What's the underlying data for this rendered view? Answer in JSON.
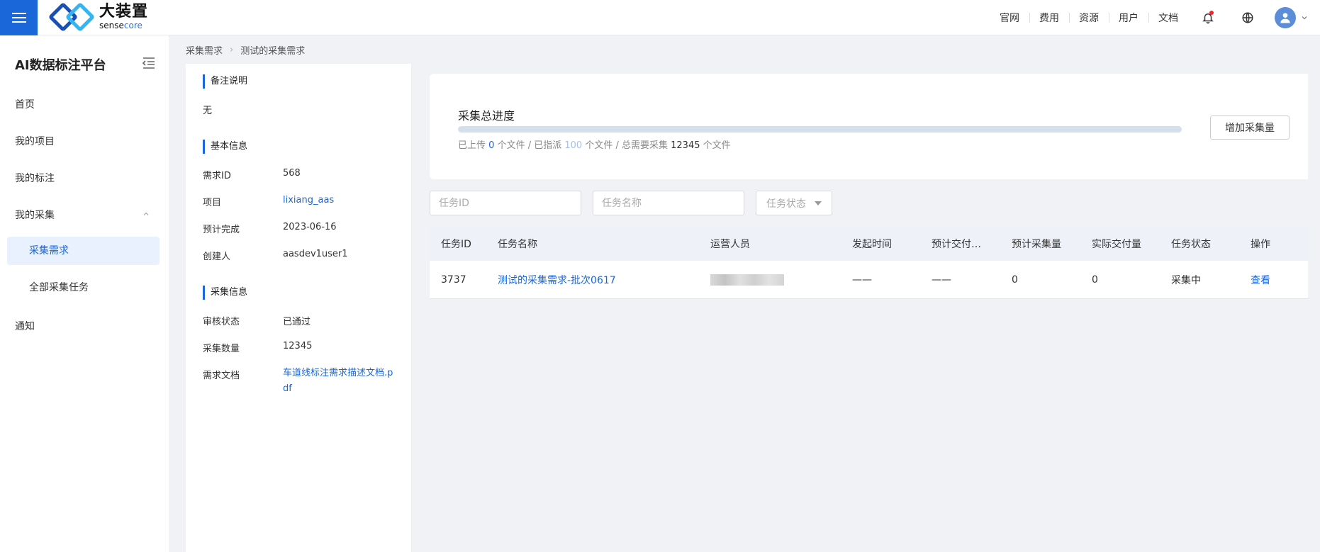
{
  "header": {
    "logo_cn": "大装置",
    "logo_en_prefix": "sense",
    "logo_en_suffix": "core",
    "nav": [
      "官网",
      "费用",
      "资源",
      "用户",
      "文档"
    ]
  },
  "sidebar": {
    "title": "AI数据标注平台",
    "items": {
      "home": "首页",
      "projects": "我的项目",
      "annotations": "我的标注",
      "collections": "我的采集",
      "collection_demand": "采集需求",
      "all_tasks": "全部采集任务",
      "notifications": "通知"
    }
  },
  "breadcrumb": {
    "parent": "采集需求",
    "current": "测试的采集需求"
  },
  "info": {
    "remarks_title": "备注说明",
    "remarks_value": "无",
    "basic_title": "基本信息",
    "basic": {
      "id_label": "需求ID",
      "id_value": "568",
      "project_label": "项目",
      "project_value": "lixiang_aas",
      "due_label": "预计完成",
      "due_value": "2023-06-16",
      "creator_label": "创建人",
      "creator_value": "aasdev1user1"
    },
    "collect_title": "采集信息",
    "collect": {
      "review_label": "审核状态",
      "review_value": "已通过",
      "count_label": "采集数量",
      "count_value": "12345",
      "doc_label": "需求文档",
      "doc_value": "车道线标注需求描述文档.pdf"
    }
  },
  "progress": {
    "title": "采集总进度",
    "uploaded_prefix": "已上传",
    "uploaded": "0",
    "unit1": "个文件 / 已指派",
    "assigned": "100",
    "unit2": "个文件 / 总需要采集",
    "total": "12345",
    "unit3": "个文件",
    "ratio": 0,
    "add_button": "增加采集量"
  },
  "filters": {
    "task_id_placeholder": "任务ID",
    "task_name_placeholder": "任务名称",
    "status_placeholder": "任务状态"
  },
  "table": {
    "headers": [
      "任务ID",
      "任务名称",
      "运营人员",
      "发起时间",
      "预计交付…",
      "预计采集量",
      "实际交付量",
      "任务状态",
      "操作"
    ],
    "rows": [
      {
        "id": "3737",
        "name": "测试的采集需求-批次0617",
        "start_time": "——",
        "delivery_time": "——",
        "planned": "0",
        "delivered": "0",
        "status": "采集中",
        "action": "查看"
      }
    ]
  },
  "colors": {
    "primary": "#1967d8",
    "active_bg": "#e8f1fd",
    "progress_track": "#d6deec",
    "alert_dot": "#f5222d"
  }
}
